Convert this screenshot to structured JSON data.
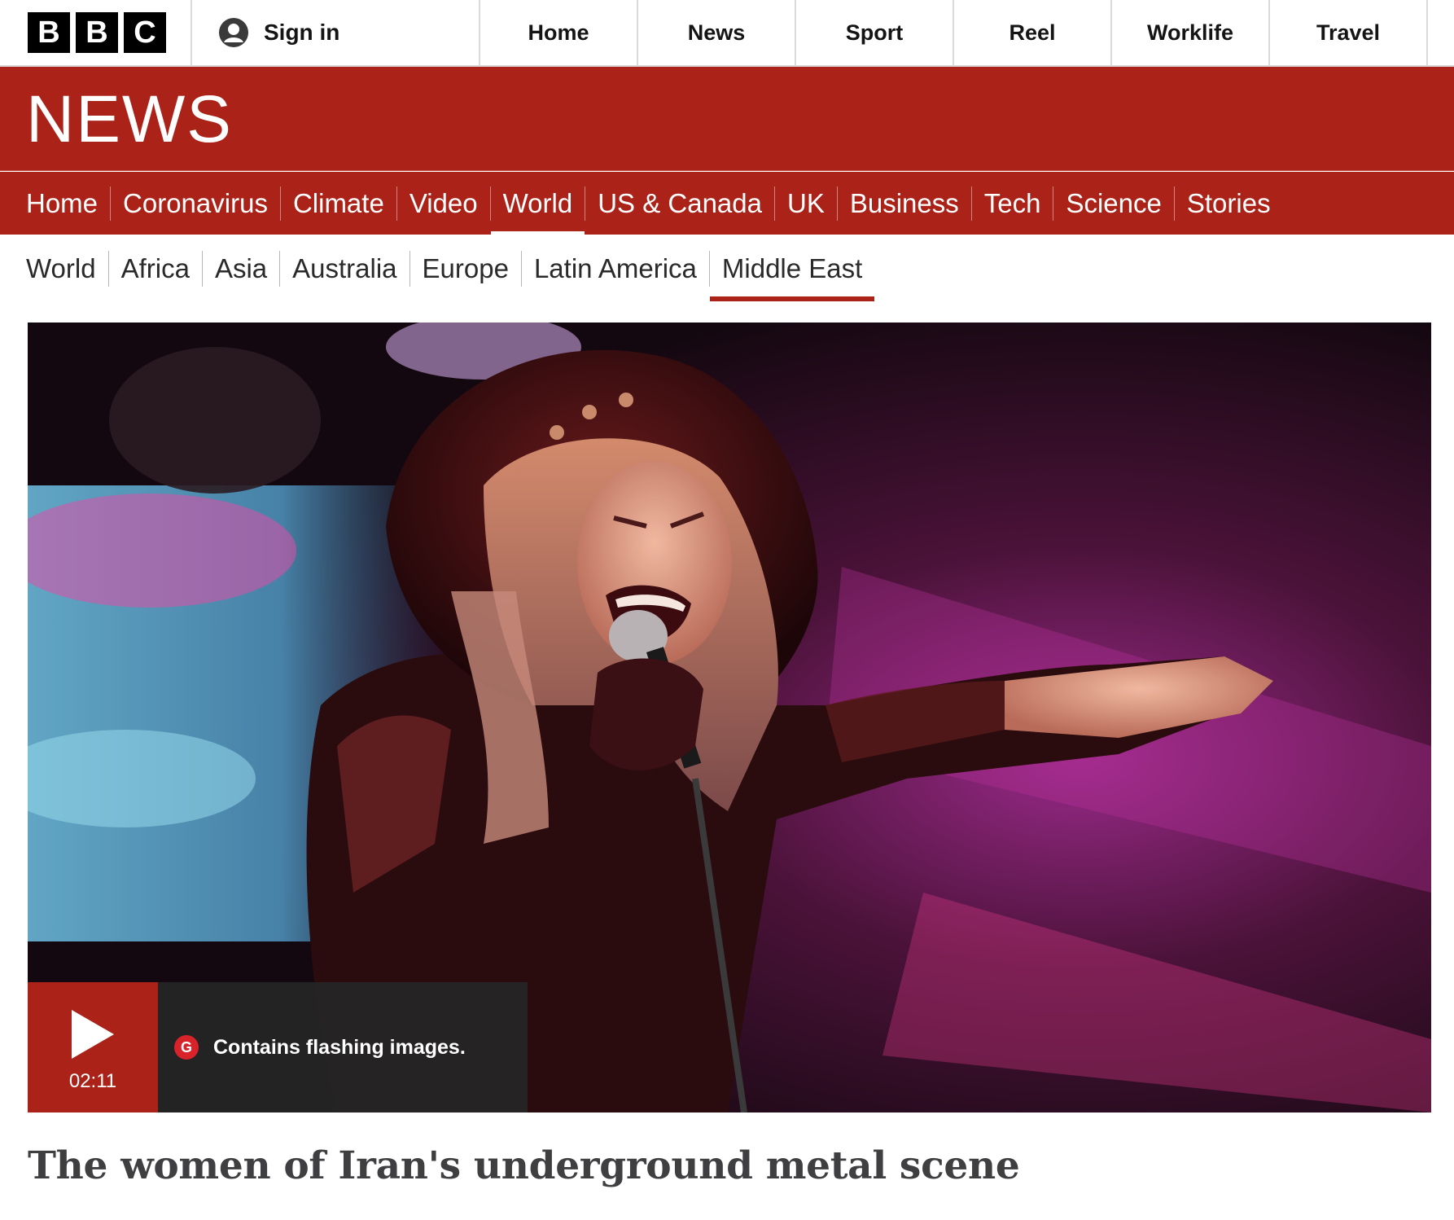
{
  "global_header": {
    "logo_letters": [
      "B",
      "B",
      "C"
    ],
    "sign_in_label": "Sign in",
    "nav_items": [
      "Home",
      "News",
      "Sport",
      "Reel",
      "Worklife",
      "Travel"
    ]
  },
  "brand": {
    "section_title": "NEWS",
    "accent_color": "#ab2218"
  },
  "primary_nav": {
    "items": [
      "Home",
      "Coronavirus",
      "Climate",
      "Video",
      "World",
      "US & Canada",
      "UK",
      "Business",
      "Tech",
      "Science",
      "Stories"
    ],
    "active": "World"
  },
  "secondary_nav": {
    "items": [
      "World",
      "Africa",
      "Asia",
      "Australia",
      "Europe",
      "Latin America",
      "Middle East"
    ],
    "active": "Middle East"
  },
  "media": {
    "duration": "02:11",
    "guidance_badge": "G",
    "guidance_text": "Contains flashing images.",
    "play_icon": "play-icon"
  },
  "article": {
    "headline": "The women of Iran's underground metal scene"
  }
}
